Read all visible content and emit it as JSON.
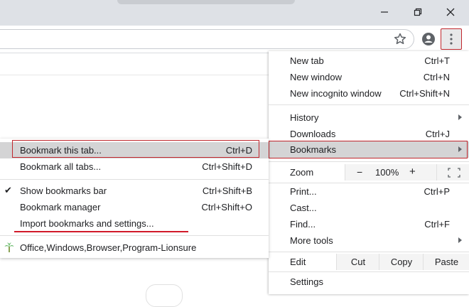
{
  "window": {
    "minimize_icon": "minimize-icon",
    "restore_icon": "restore-icon",
    "close_icon": "close-icon"
  },
  "toolbar": {
    "star_icon": "bookmark-star-icon",
    "profile_icon": "profile-icon",
    "menu_icon": "kebab-menu-icon"
  },
  "menu": {
    "new_tab": {
      "label": "New tab",
      "shortcut": "Ctrl+T"
    },
    "new_window": {
      "label": "New window",
      "shortcut": "Ctrl+N"
    },
    "new_incognito": {
      "label": "New incognito window",
      "shortcut": "Ctrl+Shift+N"
    },
    "history": {
      "label": "History"
    },
    "downloads": {
      "label": "Downloads",
      "shortcut": "Ctrl+J"
    },
    "bookmarks": {
      "label": "Bookmarks"
    },
    "zoom": {
      "label": "Zoom",
      "minus": "−",
      "value": "100%",
      "plus": "+"
    },
    "print": {
      "label": "Print...",
      "shortcut": "Ctrl+P"
    },
    "cast": {
      "label": "Cast..."
    },
    "find": {
      "label": "Find...",
      "shortcut": "Ctrl+F"
    },
    "more_tools": {
      "label": "More tools"
    },
    "edit": {
      "label": "Edit",
      "cut": "Cut",
      "copy": "Copy",
      "paste": "Paste"
    },
    "settings": {
      "label": "Settings"
    }
  },
  "bookmarks_submenu": {
    "bookmark_tab": {
      "label": "Bookmark this tab...",
      "shortcut": "Ctrl+D"
    },
    "bookmark_all": {
      "label": "Bookmark all tabs...",
      "shortcut": "Ctrl+Shift+D"
    },
    "show_bar": {
      "label": "Show bookmarks bar",
      "shortcut": "Ctrl+Shift+B",
      "checked": true
    },
    "manager": {
      "label": "Bookmark manager",
      "shortcut": "Ctrl+Shift+O"
    },
    "import": {
      "label": "Import bookmarks and settings..."
    },
    "folder": {
      "label": "Office,Windows,Browser,Program-Lionsure"
    }
  },
  "colors": {
    "highlight_border": "#c0272d",
    "underline": "#d11a2a",
    "hover_bg": "#d4d4d5",
    "favicon": "#4caf50"
  }
}
